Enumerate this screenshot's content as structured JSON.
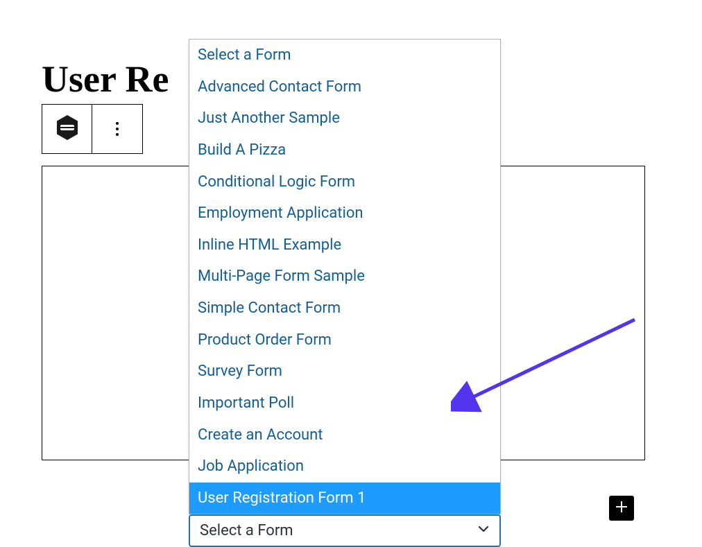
{
  "page": {
    "title": "User Re"
  },
  "dropdown": {
    "items": [
      "Select a Form",
      "Advanced Contact Form",
      "Just Another Sample",
      "Build A Pizza",
      "Conditional Logic Form",
      "Employment Application",
      "Inline HTML Example",
      "Multi-Page Form Sample",
      "Simple Contact Form",
      "Product Order Form",
      "Survey Form",
      "Important Poll",
      "Create an Account",
      "Job Application",
      "User Registration Form 1"
    ],
    "highlighted_item": "User Registration Form 1",
    "trigger_label": "Select a Form"
  },
  "colors": {
    "link": "#135e96",
    "highlight": "#1e9bff",
    "select_border": "#2271b1",
    "arrow": "#5333ed"
  }
}
